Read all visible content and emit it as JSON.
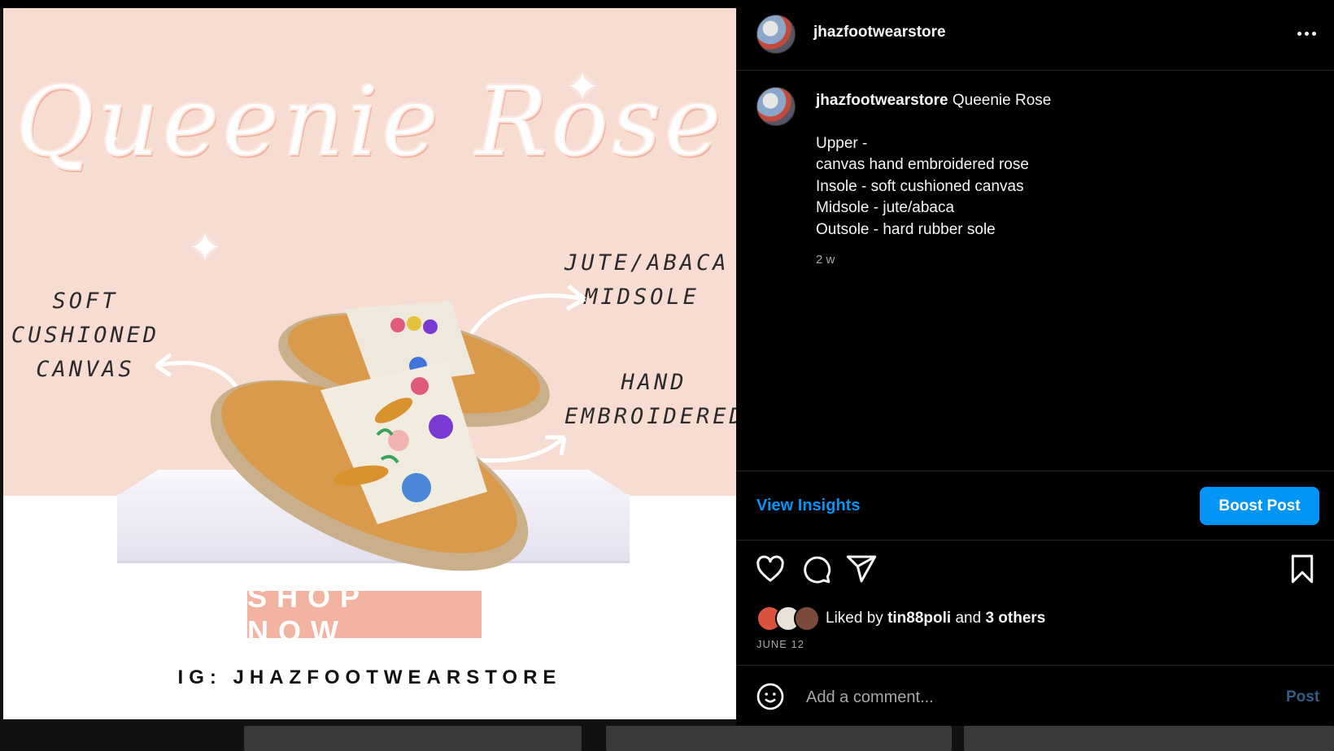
{
  "post_image": {
    "title_script": "Queenie Rose",
    "annotations": {
      "left": [
        "SOFT",
        "CUSHIONED",
        "CANVAS"
      ],
      "top_right": [
        "JUTE/ABACA",
        "MIDSOLE"
      ],
      "mid_right": [
        "HAND",
        "EMBROIDERED"
      ]
    },
    "shop_now": "SHOP NOW",
    "ig_handle": "IG: JHAZFOOTWEARSTORE",
    "colors": {
      "pink_bg": "#f7dcd2",
      "shop_button": "#f2b3a2"
    }
  },
  "header": {
    "username": "jhazfootwearstore"
  },
  "caption": {
    "username": "jhazfootwearstore",
    "title": "Queenie Rose",
    "lines": [
      "Upper -",
      "canvas hand embroidered rose",
      "Insole - soft cushioned canvas",
      "Midsole - jute/abaca",
      "Outsole - hard rubber sole"
    ],
    "time_ago": "2 w"
  },
  "insights": {
    "view_label": "View Insights",
    "boost_label": "Boost Post"
  },
  "actions": {
    "icons": [
      "heart-icon",
      "comment-icon",
      "share-icon",
      "bookmark-icon"
    ]
  },
  "likes": {
    "prefix": "Liked by",
    "user": "tin88poli",
    "connector": "and",
    "others": "3 others"
  },
  "post_date": "JUNE 12",
  "comment": {
    "placeholder": "Add a comment...",
    "post_label": "Post"
  },
  "theme": {
    "accent": "#0095f6",
    "background": "#000000",
    "muted_text": "#a8a8a8"
  }
}
